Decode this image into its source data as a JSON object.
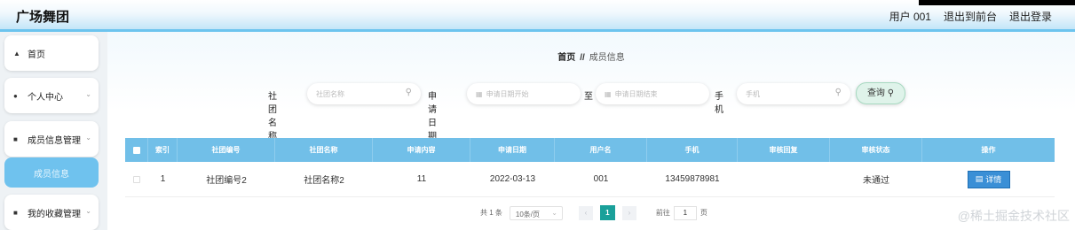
{
  "header": {
    "app_title": "广场舞团",
    "user_label": "用户 001",
    "to_front": "退出到前台",
    "logout": "退出登录"
  },
  "sidebar": {
    "items": [
      {
        "label": "首页",
        "icon": "home-icon",
        "has_chevron": false
      },
      {
        "label": "个人中心",
        "icon": "user-icon",
        "has_chevron": true
      },
      {
        "label": "成员信息管理",
        "icon": "list-icon",
        "has_chevron": true
      },
      {
        "label": "成员信息",
        "icon": "",
        "has_chevron": false,
        "active": true
      },
      {
        "label": "我的收藏管理",
        "icon": "list-icon",
        "has_chevron": true
      }
    ]
  },
  "breadcrumb": {
    "home": "首页",
    "separator": "//",
    "current": "成员信息"
  },
  "search": {
    "club_name_label": "社团名称",
    "club_name_placeholder": "社团名称",
    "apply_date_label": "申请日期",
    "date_start_placeholder": "申请日期开始",
    "to_label": "至",
    "date_end_placeholder": "申请日期结束",
    "phone_label": "手机",
    "phone_placeholder": "手机",
    "query_label": "查询"
  },
  "table": {
    "headers": [
      "索引",
      "社团编号",
      "社团名称",
      "申请内容",
      "申请日期",
      "用户名",
      "手机",
      "审核回复",
      "审核状态",
      "操作"
    ],
    "rows": [
      {
        "index": "1",
        "club_no": "社团编号2",
        "club_name": "社团名称2",
        "content": "11",
        "date": "2022-03-13",
        "username": "001",
        "phone": "13459878981",
        "reply": "",
        "status": "未通过",
        "action": "详情"
      }
    ]
  },
  "pagination": {
    "total": "共 1 条",
    "page_size": "10条/页",
    "current_page": "1",
    "goto_label": "前往",
    "goto_value": "1",
    "page_unit": "页"
  },
  "watermark": "@稀土掘金技术社区",
  "colors": {
    "accent": "#71bfe8",
    "sidebar_active": "#6fc2ee",
    "page_active": "#1aa09a",
    "detail_button": "#3a8fd6"
  }
}
